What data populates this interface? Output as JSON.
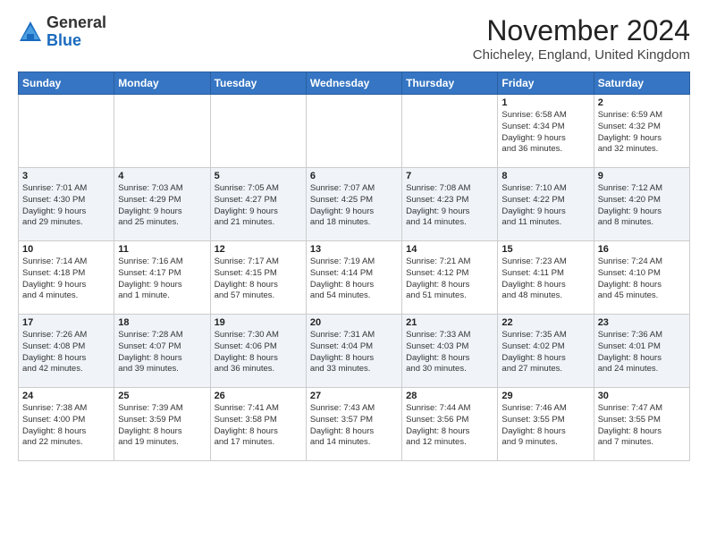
{
  "logo": {
    "general": "General",
    "blue": "Blue"
  },
  "header": {
    "month": "November 2024",
    "location": "Chicheley, England, United Kingdom"
  },
  "days_of_week": [
    "Sunday",
    "Monday",
    "Tuesday",
    "Wednesday",
    "Thursday",
    "Friday",
    "Saturday"
  ],
  "weeks": [
    {
      "days": [
        {
          "number": "",
          "info": ""
        },
        {
          "number": "",
          "info": ""
        },
        {
          "number": "",
          "info": ""
        },
        {
          "number": "",
          "info": ""
        },
        {
          "number": "",
          "info": ""
        },
        {
          "number": "1",
          "info": "Sunrise: 6:58 AM\nSunset: 4:34 PM\nDaylight: 9 hours\nand 36 minutes."
        },
        {
          "number": "2",
          "info": "Sunrise: 6:59 AM\nSunset: 4:32 PM\nDaylight: 9 hours\nand 32 minutes."
        }
      ]
    },
    {
      "days": [
        {
          "number": "3",
          "info": "Sunrise: 7:01 AM\nSunset: 4:30 PM\nDaylight: 9 hours\nand 29 minutes."
        },
        {
          "number": "4",
          "info": "Sunrise: 7:03 AM\nSunset: 4:29 PM\nDaylight: 9 hours\nand 25 minutes."
        },
        {
          "number": "5",
          "info": "Sunrise: 7:05 AM\nSunset: 4:27 PM\nDaylight: 9 hours\nand 21 minutes."
        },
        {
          "number": "6",
          "info": "Sunrise: 7:07 AM\nSunset: 4:25 PM\nDaylight: 9 hours\nand 18 minutes."
        },
        {
          "number": "7",
          "info": "Sunrise: 7:08 AM\nSunset: 4:23 PM\nDaylight: 9 hours\nand 14 minutes."
        },
        {
          "number": "8",
          "info": "Sunrise: 7:10 AM\nSunset: 4:22 PM\nDaylight: 9 hours\nand 11 minutes."
        },
        {
          "number": "9",
          "info": "Sunrise: 7:12 AM\nSunset: 4:20 PM\nDaylight: 9 hours\nand 8 minutes."
        }
      ]
    },
    {
      "days": [
        {
          "number": "10",
          "info": "Sunrise: 7:14 AM\nSunset: 4:18 PM\nDaylight: 9 hours\nand 4 minutes."
        },
        {
          "number": "11",
          "info": "Sunrise: 7:16 AM\nSunset: 4:17 PM\nDaylight: 9 hours\nand 1 minute."
        },
        {
          "number": "12",
          "info": "Sunrise: 7:17 AM\nSunset: 4:15 PM\nDaylight: 8 hours\nand 57 minutes."
        },
        {
          "number": "13",
          "info": "Sunrise: 7:19 AM\nSunset: 4:14 PM\nDaylight: 8 hours\nand 54 minutes."
        },
        {
          "number": "14",
          "info": "Sunrise: 7:21 AM\nSunset: 4:12 PM\nDaylight: 8 hours\nand 51 minutes."
        },
        {
          "number": "15",
          "info": "Sunrise: 7:23 AM\nSunset: 4:11 PM\nDaylight: 8 hours\nand 48 minutes."
        },
        {
          "number": "16",
          "info": "Sunrise: 7:24 AM\nSunset: 4:10 PM\nDaylight: 8 hours\nand 45 minutes."
        }
      ]
    },
    {
      "days": [
        {
          "number": "17",
          "info": "Sunrise: 7:26 AM\nSunset: 4:08 PM\nDaylight: 8 hours\nand 42 minutes."
        },
        {
          "number": "18",
          "info": "Sunrise: 7:28 AM\nSunset: 4:07 PM\nDaylight: 8 hours\nand 39 minutes."
        },
        {
          "number": "19",
          "info": "Sunrise: 7:30 AM\nSunset: 4:06 PM\nDaylight: 8 hours\nand 36 minutes."
        },
        {
          "number": "20",
          "info": "Sunrise: 7:31 AM\nSunset: 4:04 PM\nDaylight: 8 hours\nand 33 minutes."
        },
        {
          "number": "21",
          "info": "Sunrise: 7:33 AM\nSunset: 4:03 PM\nDaylight: 8 hours\nand 30 minutes."
        },
        {
          "number": "22",
          "info": "Sunrise: 7:35 AM\nSunset: 4:02 PM\nDaylight: 8 hours\nand 27 minutes."
        },
        {
          "number": "23",
          "info": "Sunrise: 7:36 AM\nSunset: 4:01 PM\nDaylight: 8 hours\nand 24 minutes."
        }
      ]
    },
    {
      "days": [
        {
          "number": "24",
          "info": "Sunrise: 7:38 AM\nSunset: 4:00 PM\nDaylight: 8 hours\nand 22 minutes."
        },
        {
          "number": "25",
          "info": "Sunrise: 7:39 AM\nSunset: 3:59 PM\nDaylight: 8 hours\nand 19 minutes."
        },
        {
          "number": "26",
          "info": "Sunrise: 7:41 AM\nSunset: 3:58 PM\nDaylight: 8 hours\nand 17 minutes."
        },
        {
          "number": "27",
          "info": "Sunrise: 7:43 AM\nSunset: 3:57 PM\nDaylight: 8 hours\nand 14 minutes."
        },
        {
          "number": "28",
          "info": "Sunrise: 7:44 AM\nSunset: 3:56 PM\nDaylight: 8 hours\nand 12 minutes."
        },
        {
          "number": "29",
          "info": "Sunrise: 7:46 AM\nSunset: 3:55 PM\nDaylight: 8 hours\nand 9 minutes."
        },
        {
          "number": "30",
          "info": "Sunrise: 7:47 AM\nSunset: 3:55 PM\nDaylight: 8 hours\nand 7 minutes."
        }
      ]
    }
  ]
}
